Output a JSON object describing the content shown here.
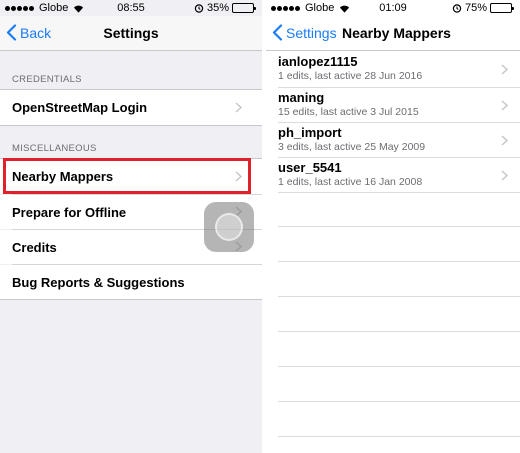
{
  "left_screen": {
    "status_bar": {
      "carrier": "Globe",
      "time": "08:55",
      "battery_percent": "35%",
      "battery_level": 0.35
    },
    "nav": {
      "back_label": "Back",
      "title": "Settings"
    },
    "sections": [
      {
        "header": "CREDENTIALS",
        "items": [
          {
            "label": "OpenStreetMap Login"
          }
        ]
      },
      {
        "header": "MISCELLANEOUS",
        "items": [
          {
            "label": "Nearby Mappers",
            "highlighted": true
          },
          {
            "label": "Prepare for Offline"
          },
          {
            "label": "Credits"
          },
          {
            "label": "Bug Reports & Suggestions"
          }
        ]
      }
    ]
  },
  "right_screen": {
    "status_bar": {
      "carrier": "Globe",
      "time": "01:09",
      "battery_percent": "75%",
      "battery_level": 0.75
    },
    "nav": {
      "back_label": "Settings",
      "title": "Nearby Mappers"
    },
    "mappers": [
      {
        "name": "ianlopez1115",
        "detail": "1 edits, last active 28 Jun 2016"
      },
      {
        "name": "maning",
        "detail": "15 edits, last active 3 Jul 2015"
      },
      {
        "name": "ph_import",
        "detail": "3 edits, last active 25 May 2009"
      },
      {
        "name": "user_5541",
        "detail": "1 edits, last active 16 Jan 2008"
      }
    ]
  },
  "colors": {
    "accent": "#1a7cf6",
    "highlight_border": "#e0202a",
    "battery": "#f2c200"
  }
}
